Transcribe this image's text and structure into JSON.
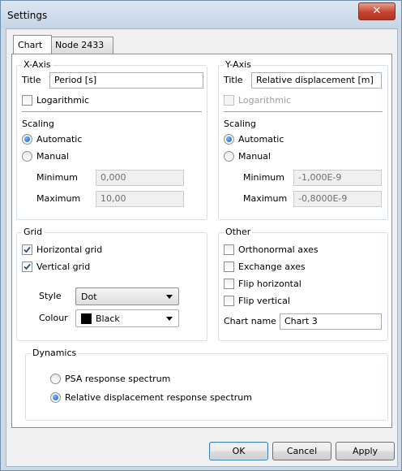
{
  "window": {
    "title": "Settings",
    "close_glyph": "✕"
  },
  "tabs": [
    {
      "label": "Chart",
      "active": true
    },
    {
      "label": "Node 2433",
      "active": false
    }
  ],
  "x_axis": {
    "legend": "X-Axis",
    "title_label": "Title",
    "title_value": "Period [s]",
    "logarithmic_label": "Logarithmic",
    "logarithmic_checked": false,
    "scaling_label": "Scaling",
    "automatic_label": "Automatic",
    "manual_label": "Manual",
    "scaling_selected": "Automatic",
    "minimum_label": "Minimum",
    "minimum_value": "0,000",
    "maximum_label": "Maximum",
    "maximum_value": "10,00"
  },
  "y_axis": {
    "legend": "Y-Axis",
    "title_label": "Title",
    "title_value": "Relative displacement [m]",
    "logarithmic_label": "Logarithmic",
    "logarithmic_checked": false,
    "scaling_label": "Scaling",
    "automatic_label": "Automatic",
    "manual_label": "Manual",
    "scaling_selected": "Automatic",
    "minimum_label": "Minimum",
    "minimum_value": "-1,000E-9",
    "maximum_label": "Maximum",
    "maximum_value": "-0,8000E-9"
  },
  "grid": {
    "legend": "Grid",
    "horizontal_label": "Horizontal grid",
    "horizontal_checked": true,
    "vertical_label": "Vertical grid",
    "vertical_checked": true,
    "style_label": "Style",
    "style_value": "Dot",
    "colour_label": "Colour",
    "colour_value": "Black",
    "colour_swatch": "#000000"
  },
  "other": {
    "legend": "Other",
    "orthonormal_label": "Orthonormal axes",
    "exchange_label": "Exchange axes",
    "flip_h_label": "Flip horizontal",
    "flip_v_label": "Flip vertical",
    "chart_name_label": "Chart name",
    "chart_name_value": "Chart 3"
  },
  "dynamics": {
    "legend": "Dynamics",
    "psa_label": "PSA response spectrum",
    "rel_label": "Relative displacement response spectrum",
    "selected": "Relative displacement response spectrum"
  },
  "buttons": {
    "ok": "OK",
    "cancel": "Cancel",
    "apply": "Apply"
  },
  "colors": {
    "accent": "#0f5cc0",
    "close": "#c7432e"
  }
}
